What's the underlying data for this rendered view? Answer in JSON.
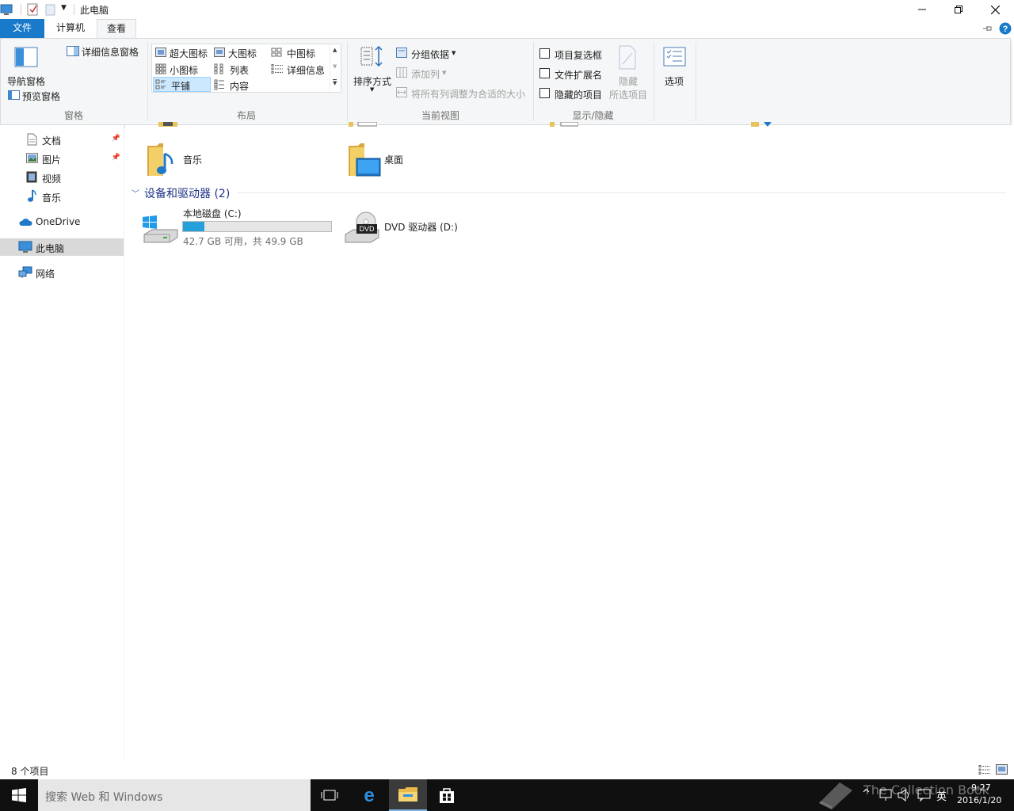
{
  "window": {
    "title": "此电脑"
  },
  "tabs": {
    "file": "文件",
    "computer": "计算机",
    "view": "查看"
  },
  "ribbon": {
    "panes": {
      "nav_pane": "导航窗格",
      "preview_pane": "预览窗格",
      "details_pane": "详细信息窗格",
      "group_label": "窗格"
    },
    "layout": {
      "extra_large": "超大图标",
      "large": "大图标",
      "medium": "中图标",
      "small": "小图标",
      "list": "列表",
      "details": "详细信息",
      "tiles": "平铺",
      "content": "内容",
      "group_label": "布局"
    },
    "current_view": {
      "sort_by": "排序方式",
      "group_by": "分组依据",
      "add_columns": "添加列",
      "size_all_columns": "将所有列调整为合适的大小",
      "group_label": "当前视图"
    },
    "show_hide": {
      "item_checkboxes": "项目复选框",
      "file_extensions": "文件扩展名",
      "hidden_items": "隐藏的项目",
      "hide_selected_1": "隐藏",
      "hide_selected_2": "所选项目",
      "group_label": "显示/隐藏"
    },
    "options": "选项"
  },
  "nav": {
    "documents": "文档",
    "pictures": "图片",
    "videos": "视频",
    "music": "音乐",
    "onedrive": "OneDrive",
    "this_pc": "此电脑",
    "network": "网络"
  },
  "content": {
    "folders": {
      "music": "音乐",
      "desktop": "桌面"
    },
    "devices_header": "设备和驱动器 (2)",
    "drive_c": {
      "name": "本地磁盘 (C:)",
      "free_text": "42.7 GB 可用，共 49.9 GB",
      "used_fraction": 0.144
    },
    "drive_d": {
      "name": "DVD 驱动器 (D:)",
      "badge": "DVD"
    }
  },
  "status": {
    "item_count": "8 个项目"
  },
  "taskbar": {
    "search_placeholder": "搜索 Web 和 Windows",
    "time": "9:27",
    "date": "2016/1/20",
    "ime": "英",
    "watermark": "The Collection Book"
  },
  "colors": {
    "accent": "#1979ca",
    "selection": "#cce8ff",
    "drive_bar": "#26a0da",
    "taskbar": "#101010"
  }
}
